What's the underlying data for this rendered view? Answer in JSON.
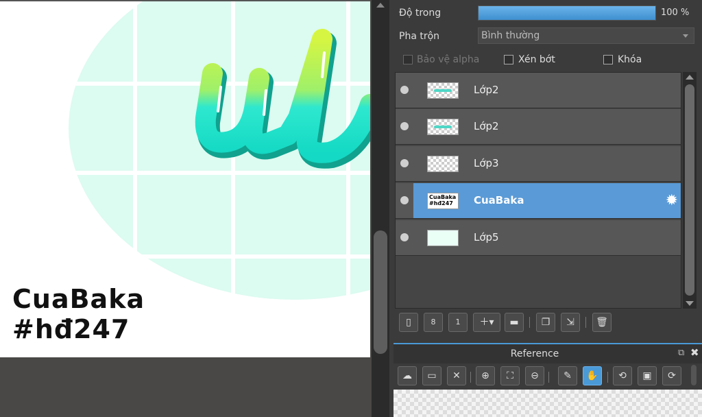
{
  "canvas": {
    "art_word": "ulo",
    "watermark_line1": "CuaBaka",
    "watermark_line2": "#hđ247",
    "colors": {
      "bubble": "#dcfbf1",
      "grid": "#ffffff",
      "letters_top": "#c9f03a",
      "letters_bottom": "#1de8cc",
      "letters_shadow": "#10a28e"
    }
  },
  "properties": {
    "opacity_label": "Độ trong",
    "opacity_value_text": "100 %",
    "opacity_percent": 100,
    "blend_label": "Pha trộn",
    "blend_value": "Bình thường",
    "protect_alpha_label": "Bảo vệ alpha",
    "clip_label": "Xén bớt",
    "lock_label": "Khóa"
  },
  "layers": [
    {
      "name": "Lớp2",
      "thumb": "wave",
      "selected": false
    },
    {
      "name": "Lớp2",
      "thumb": "wave",
      "selected": false
    },
    {
      "name": "Lớp3",
      "thumb": "empty",
      "selected": false
    },
    {
      "name": "CuaBaka",
      "thumb": "text",
      "thumb_text": "CuaBaka #hđ247",
      "selected": true
    },
    {
      "name": "Lớp5",
      "thumb": "white",
      "selected": false
    }
  ],
  "layer_toolbar_icons": [
    "new-layer-icon",
    "new-8bit-layer-icon",
    "new-1bit-layer-icon",
    "add-layer-dropdown-icon",
    "new-folder-icon",
    "duplicate-layer-icon",
    "merge-down-icon",
    "delete-layer-icon"
  ],
  "reference": {
    "title": "Reference",
    "toolbar_icons": [
      "load-reference-icon",
      "open-folder-icon",
      "close-reference-icon",
      "zoom-in-icon",
      "fit-view-icon",
      "zoom-out-icon",
      "eyedropper-icon",
      "hand-pan-icon",
      "rotate-left-icon",
      "fit-screen-icon",
      "rotate-right-icon"
    ],
    "active_tool": "hand-pan-icon"
  },
  "accent_color": "#5a9ad6"
}
